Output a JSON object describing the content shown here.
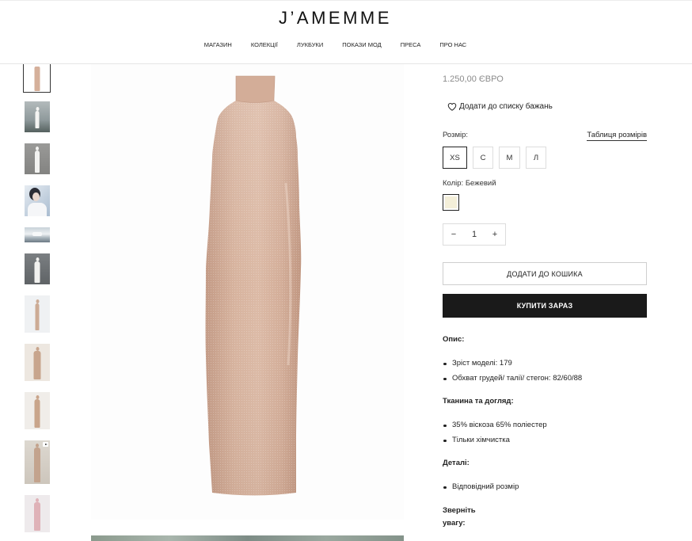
{
  "header": {
    "logo": "J’AMEMME",
    "nav": [
      {
        "label": "МАГАЗИН"
      },
      {
        "label": "КОЛЕКЦІЇ"
      },
      {
        "label": "ЛУКБУКИ"
      },
      {
        "label": "ПОКАЗИ МОД"
      },
      {
        "label": "ПРЕСА"
      },
      {
        "label": "ПРО НАС"
      }
    ]
  },
  "product": {
    "price": "1.250,00 ЄВРО",
    "wishlist": {
      "icon": "heart-icon",
      "label": "Додати до списку бажань"
    },
    "size": {
      "label": "Розмір:",
      "chart_link": "Таблиця розмірів",
      "options": [
        {
          "label": "XS",
          "selected": true
        },
        {
          "label": "С",
          "selected": false
        },
        {
          "label": "М",
          "selected": false
        },
        {
          "label": "Л",
          "selected": false
        }
      ]
    },
    "color": {
      "label": "Колір: Бежевий",
      "swatch": "#f4efd9"
    },
    "quantity": {
      "minus": "−",
      "value": "1",
      "plus": "+"
    },
    "add_to_cart": "ДОДАТИ ДО КОШИКА",
    "buy_now": "КУПИТИ ЗАРАЗ",
    "details": [
      {
        "title": "Опис:",
        "items": [
          "Зріст моделі: 179",
          "Обхват грудей/ талії/ стегон: 82/60/88"
        ]
      },
      {
        "title": "Тканина та догляд:",
        "items": [
          "35% віскоза 65% поліестер",
          "Тільки хімчистка"
        ]
      },
      {
        "title": "Деталі:",
        "items": [
          "Відповідний розмір"
        ]
      },
      {
        "title": "Зверніть увагу:",
        "items": []
      }
    ]
  },
  "colors": {
    "accent": "#1a1a1a"
  }
}
